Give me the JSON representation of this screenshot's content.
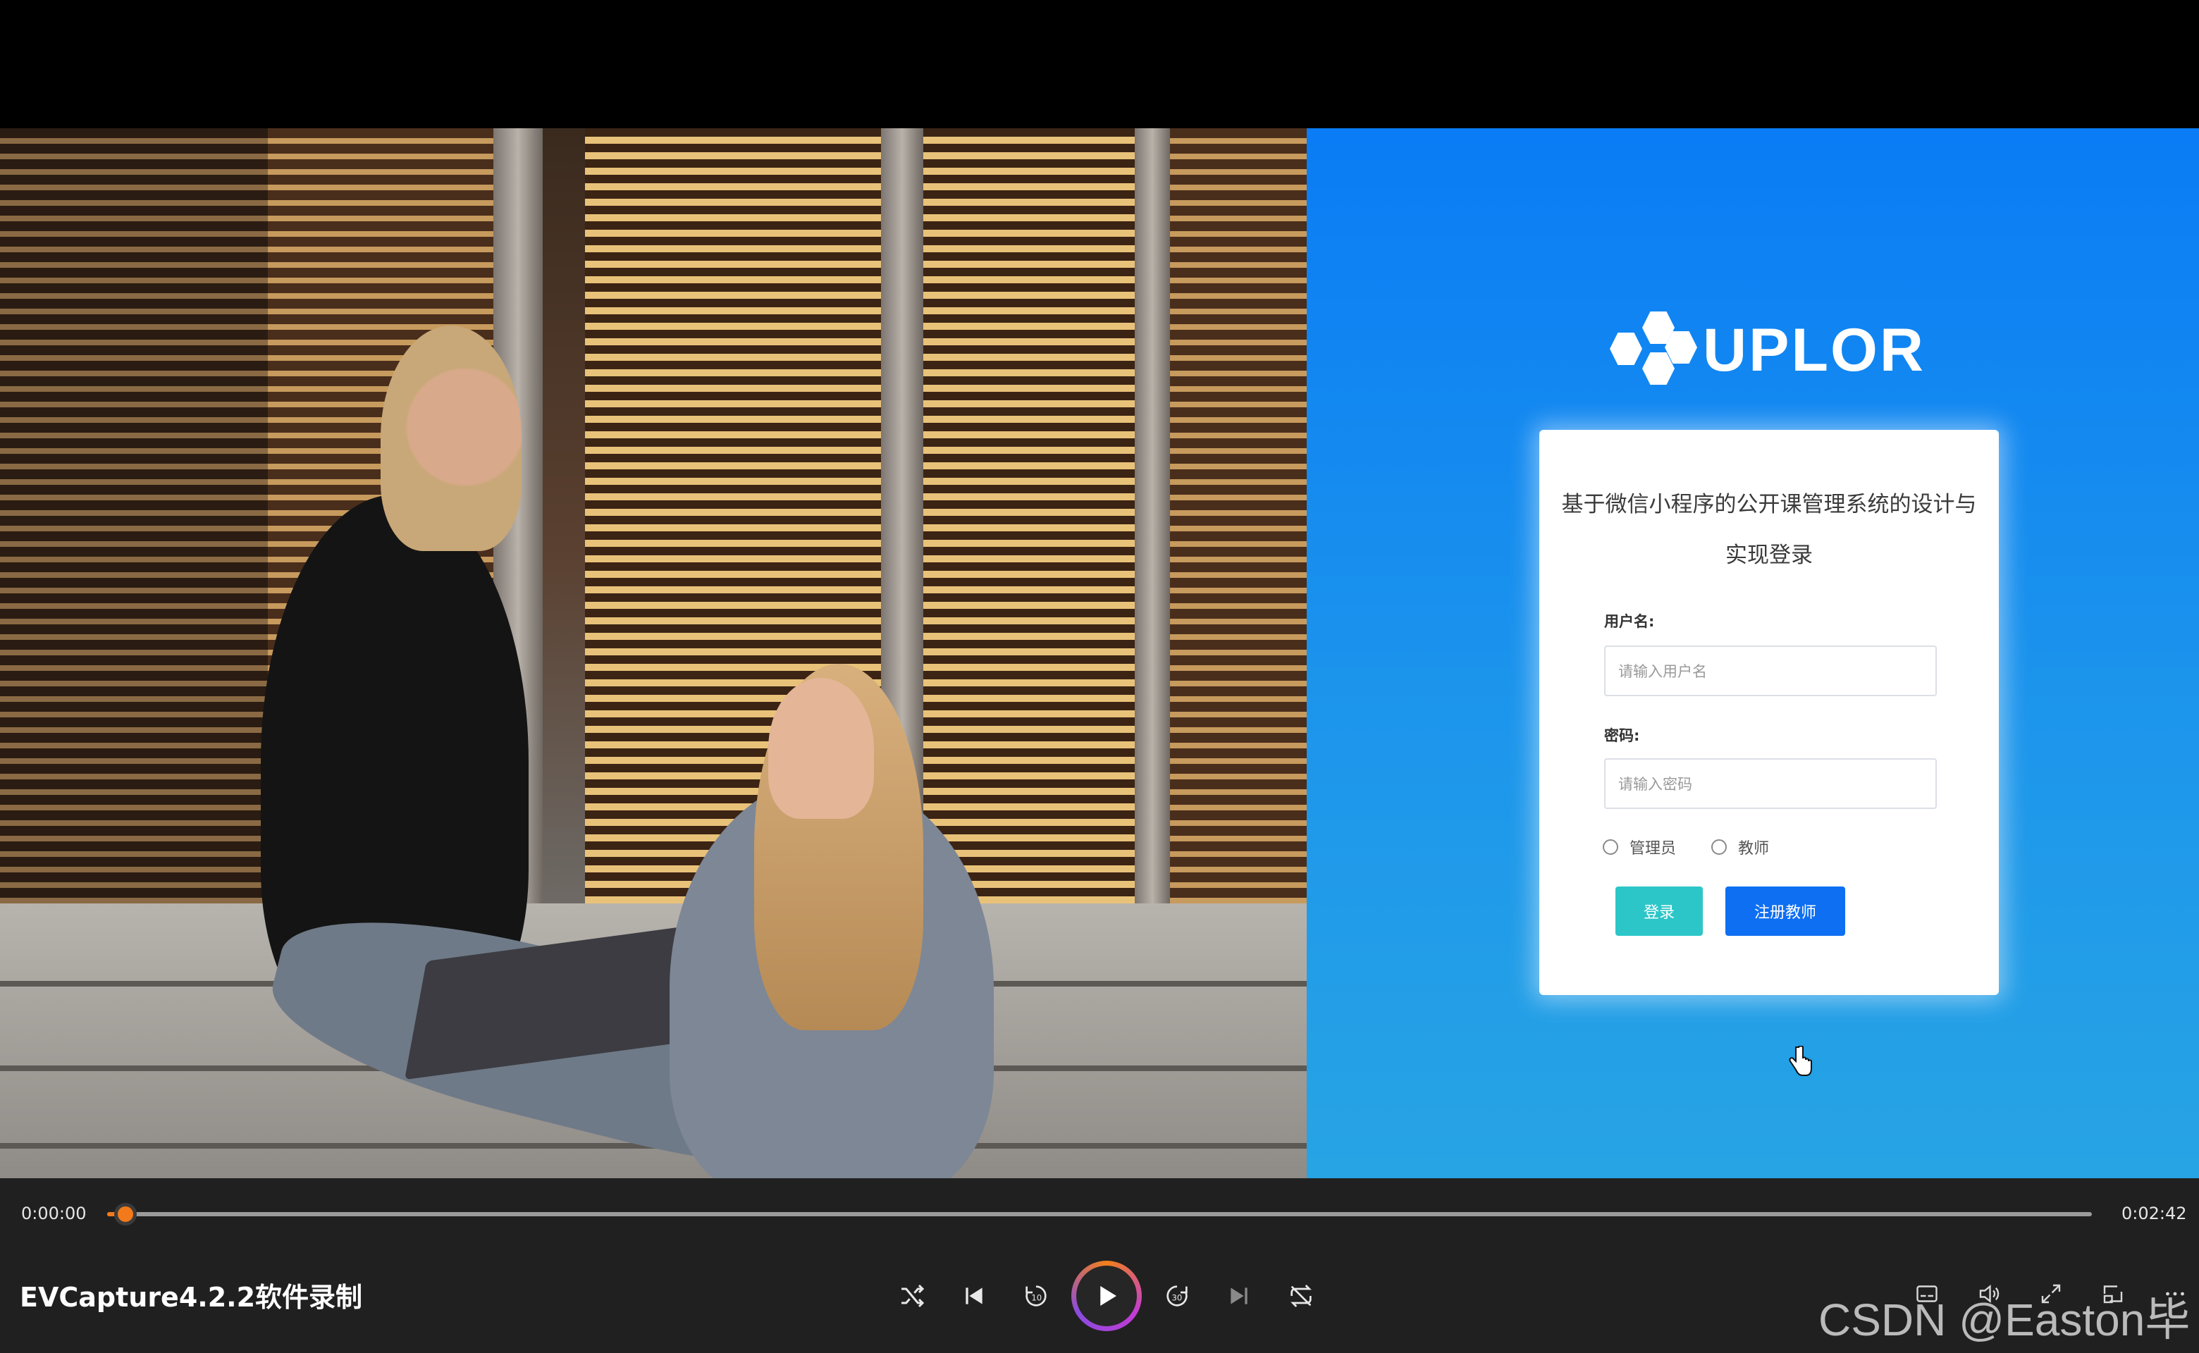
{
  "brand": {
    "name": "UPLOR"
  },
  "login": {
    "title": "基于微信小程序的公开课管理系统的设计与实现登录",
    "username_label": "用户名:",
    "username_placeholder": "请输入用户名",
    "password_label": "密码:",
    "password_placeholder": "请输入密码",
    "roles": [
      "管理员",
      "教师"
    ],
    "login_button": "登录",
    "register_button": "注册教师"
  },
  "player": {
    "current_time": "0:00:00",
    "total_time": "0:02:42",
    "progress_fraction": 0.005,
    "title": "EVCapture4.2.2软件录制",
    "controls": [
      "shuffle-icon",
      "previous-icon",
      "rewind-10-icon",
      "play-icon",
      "forward-30-icon",
      "next-icon",
      "repeat-off-icon"
    ],
    "tools": [
      "subtitles-icon",
      "volume-icon",
      "fullscreen-icon",
      "mini-player-icon",
      "more-icon"
    ]
  },
  "watermark": "CSDN @Easton毕设",
  "colors": {
    "login_bg": "#0a7cf5",
    "login_button": "#2cc6c8",
    "register_button": "#0e6ff2",
    "seek_accent": "#f27a1a"
  }
}
